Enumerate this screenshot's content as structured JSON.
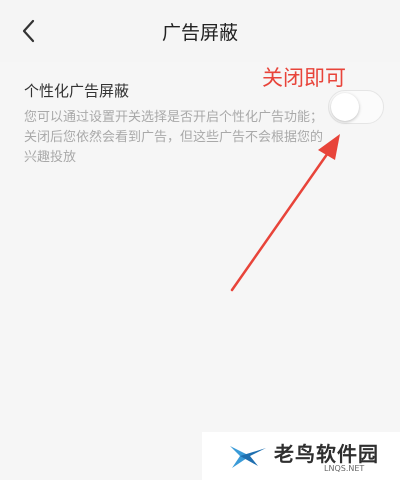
{
  "header": {
    "title": "广告屏蔽",
    "back_icon": "chevron-left-icon"
  },
  "setting": {
    "title": "个性化广告屏蔽",
    "description": "您可以通过设置开关选择是否开启个性化广告功能；关闭后您依然会看到广告，但这些广告不会根据您的兴趣投放",
    "toggle_on": false
  },
  "annotation": {
    "text": "关闭即可",
    "color": "#e8443a"
  },
  "watermark": {
    "name": "老鸟软件园",
    "domain": "LNQS.NET",
    "logo_icon": "bird-logo-icon"
  }
}
